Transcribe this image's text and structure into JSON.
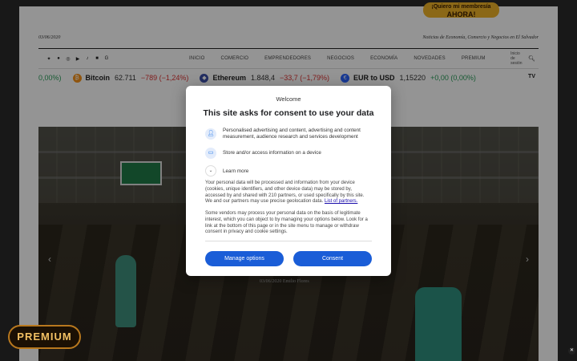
{
  "promo": {
    "line1": "¡Quiero mi membresía",
    "line2": "AHORA!"
  },
  "header": {
    "date": "03/06/2020",
    "tagline": "Noticias de Economía, Comercio y Negocios en El Salvador"
  },
  "social_icons": [
    "twitter-icon",
    "facebook-icon",
    "instagram-icon",
    "youtube-icon",
    "tiktok-icon",
    "linkedin-icon",
    "google-icon"
  ],
  "menu": [
    "INICIO",
    "COMERCIO",
    "EMPRENDEDORES",
    "NEGOCIOS",
    "ECONOMÍA",
    "NOVEDADES",
    "PREMIUM"
  ],
  "login": "Inicio de sesión",
  "ticker": {
    "leading": "0,00%)",
    "items": [
      {
        "symbol": "Bitcoin",
        "price": "62.711",
        "change": "−789 (−1,24%)",
        "status": "neg",
        "icon_color": "#f7931a",
        "icon": "₿"
      },
      {
        "symbol": "Ethereum",
        "price": "1.848,4",
        "change": "−33,7 (−1,79%)",
        "status": "neg",
        "icon_color": "#3c4fa8",
        "icon": "◆"
      },
      {
        "symbol": "EUR to USD",
        "price": "1,15220",
        "change": "+0,00 (0,00%)",
        "status": "pos",
        "icon_color": "#2962ff",
        "icon": "€"
      }
    ],
    "logo": "TV"
  },
  "hero": {
    "caption": "03/06/2020 Emilio Flores"
  },
  "premium_badge": "PREMIUM",
  "consent": {
    "welcome": "Welcome",
    "title": "This site asks for consent to use your data",
    "purposes": [
      {
        "icon": "person-icon",
        "text": "Personalised advertising and content, advertising and content measurement, audience research and services development"
      },
      {
        "icon": "device-icon",
        "text": "Store and/or access information on a device"
      }
    ],
    "learn_more": "Learn more",
    "body1": "Your personal data will be processed and information from your device (cookies, unique identifiers, and other device data) may be stored by, accessed by and shared with 210 partners, or used specifically by this site. We and our partners may use precise geolocation data.",
    "partners_link": "List of partners.",
    "body2": "Some vendors may process your personal data on the basis of legitimate interest, which you can object to by managing your options below. Look for a link at the bottom of this page or in the site menu to manage or withdraw consent in privacy and cookie settings.",
    "manage_label": "Manage options",
    "consent_label": "Consent"
  }
}
